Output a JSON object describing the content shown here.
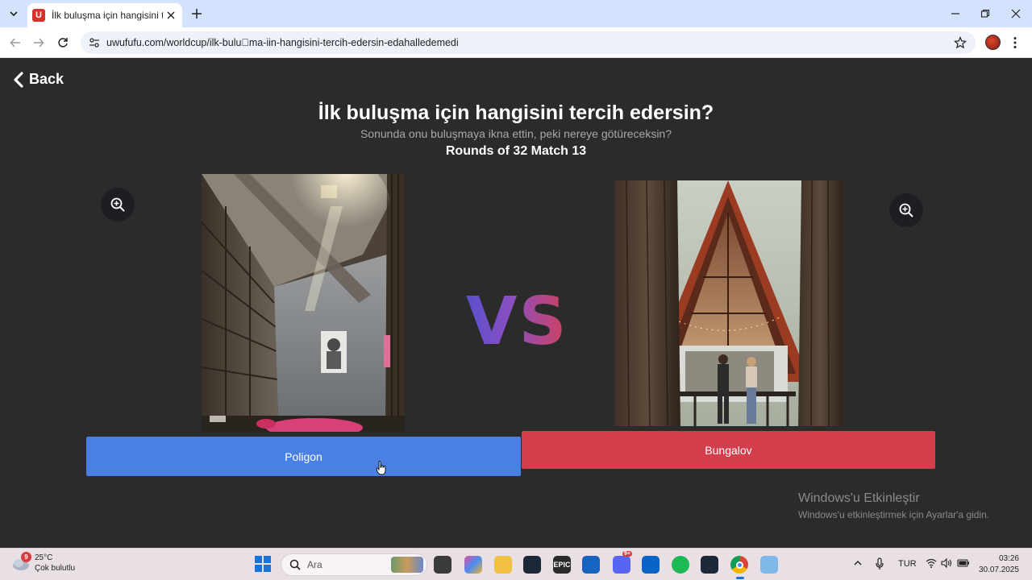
{
  "browser": {
    "tab_title": "İlk buluşma için hangisini tercih edersin?",
    "favicon_letter": "U",
    "url": "uwufufu.com/worldcup/ilk-bulu\u0000ma-iin-hangisini-tercih-edersin-edahalledemedi"
  },
  "page": {
    "back_label": "Back",
    "title": "İlk buluşma için hangisini tercih edersin?",
    "subtitle": "Sonunda onu buluşmaya ikna ettin, peki nereye götüreceksin?",
    "round": "Rounds of 32 Match 13",
    "vs": "VS",
    "left_choice": "Poligon",
    "right_choice": "Bungalov"
  },
  "activation": {
    "title": "Windows'u Etkinleştir",
    "subtitle": "Windows'u etkinleştirmek için Ayarlar'a gidin."
  },
  "taskbar": {
    "weather_badge": "9",
    "temperature": "25°C",
    "weather_desc": "Çok bulutlu",
    "search_label": "Ara",
    "language": "TUR",
    "time": "03:26",
    "date": "30.07.2025",
    "epic_label": "EPIC",
    "discord_badge": "9+"
  },
  "colors": {
    "left_button": "#4a80e3",
    "right_button": "#d23e4b",
    "page_bg": "#2b2b2b"
  }
}
